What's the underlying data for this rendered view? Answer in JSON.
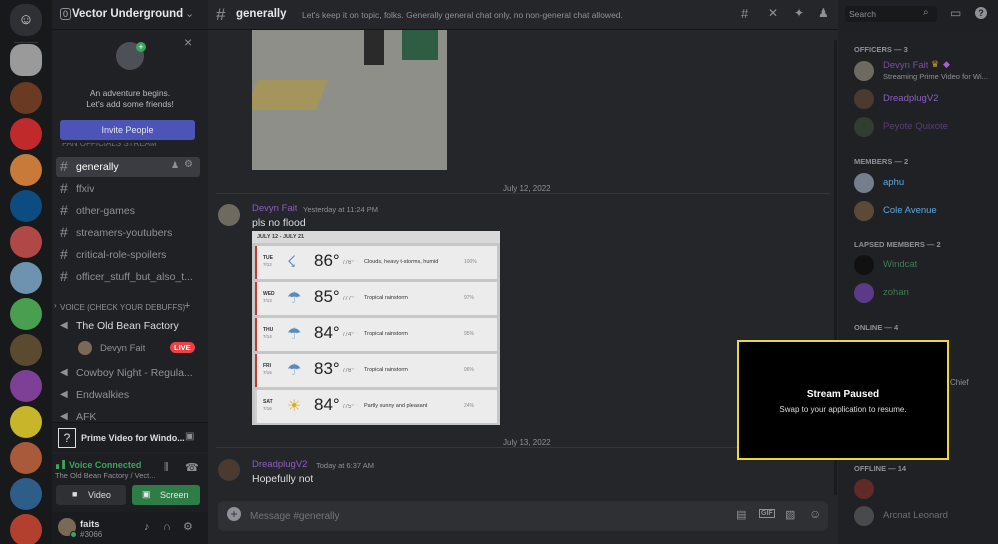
{
  "server": {
    "name": "Vector Underground",
    "badge": "0"
  },
  "promo": {
    "line1": "An adventure begins.",
    "line2": "Let's add some friends!",
    "invite": "Invite People"
  },
  "category_cutoff": "FAN OFFICIALS STREAM",
  "channels": [
    {
      "name": "generally",
      "active": true
    },
    {
      "name": "ffxiv"
    },
    {
      "name": "other-games"
    },
    {
      "name": "streamers-youtubers"
    },
    {
      "name": "critical-role-spoilers"
    },
    {
      "name": "officer_stuff_but_also_t..."
    }
  ],
  "voice": {
    "category": "VOICE (CHECK YOUR DEBUFFS)",
    "channels": [
      {
        "name": "The Old Bean Factory"
      },
      {
        "name": "Cowboy Night - Regula..."
      },
      {
        "name": "Endwalkies"
      },
      {
        "name": "AFK"
      }
    ],
    "user": "Devyn Fait",
    "live": "LIVE"
  },
  "activity": "Prime Video for Windo...",
  "connection": {
    "status": "Voice Connected",
    "channel": "The Old Bean Factory / Vect...",
    "video": "Video",
    "screen": "Screen"
  },
  "self": {
    "name": "faits",
    "tag": "#3066"
  },
  "header": {
    "channel": "generally",
    "topic": "Let's keep it on topic, folks. Generally general chat only, no non-general chat allowed.",
    "search": "Search"
  },
  "messages": {
    "divider1": "July 12, 2022",
    "m1": {
      "author": "Devyn Fait",
      "time": "Yesterday at 11:24 PM",
      "text": "pls no flood"
    },
    "divider2": "July 13, 2022",
    "m2": {
      "author": "DreadplugV2",
      "time": "Today at 6:37 AM",
      "text": "Hopefully not"
    }
  },
  "forecast": {
    "range": "JULY 12 - JULY 21",
    "days": [
      {
        "day": "TUE",
        "date": "7/12",
        "hi": "86°",
        "lo": "/76°",
        "desc": "Clouds, heavy t-storms, humid",
        "precip": "100%"
      },
      {
        "day": "WED",
        "date": "7/13",
        "hi": "85°",
        "lo": "/77°",
        "desc": "Tropical rainstorm",
        "precip": "97%"
      },
      {
        "day": "THU",
        "date": "7/14",
        "hi": "84°",
        "lo": "/74°",
        "desc": "Tropical rainstorm",
        "precip": "95%"
      },
      {
        "day": "FRI",
        "date": "7/15",
        "hi": "83°",
        "lo": "/76°",
        "desc": "Tropical rainstorm",
        "precip": "96%"
      },
      {
        "day": "SAT",
        "date": "7/16",
        "hi": "84°",
        "lo": "/75°",
        "desc": "Partly sunny and pleasant",
        "precip": "24%"
      }
    ]
  },
  "composer": {
    "placeholder": "Message #generally"
  },
  "member_groups": {
    "officers": {
      "label": "OFFICERS — 3",
      "members": [
        {
          "name": "Devyn Fait",
          "status": "Streaming Prime Video for Wi..."
        },
        {
          "name": "DreadplugV2"
        },
        {
          "name": "Peyote Quixote"
        }
      ]
    },
    "members": {
      "label": "MEMBERS — 2",
      "members": [
        {
          "name": "aphu"
        },
        {
          "name": "Cole Avenue"
        }
      ]
    },
    "lapsed": {
      "label": "LAPSED MEMBERS — 2",
      "members": [
        {
          "name": "Windcat"
        },
        {
          "name": "zohan"
        }
      ]
    },
    "online": {
      "label": "ONLINE — 4",
      "partial": "Chief"
    },
    "offline": {
      "label": "OFFLINE — 14",
      "members": [
        {
          "name": "Arcnat Leonard"
        }
      ]
    }
  },
  "stream": {
    "title": "Stream Paused",
    "subtitle": "Swap to your application to resume."
  },
  "colors": {
    "accent": "#5865f2",
    "green": "#3ba55d",
    "officer": "#8b5fbf",
    "live": "#ed4245",
    "member": "#5aa9e6",
    "highlight": "#e8d83a"
  }
}
